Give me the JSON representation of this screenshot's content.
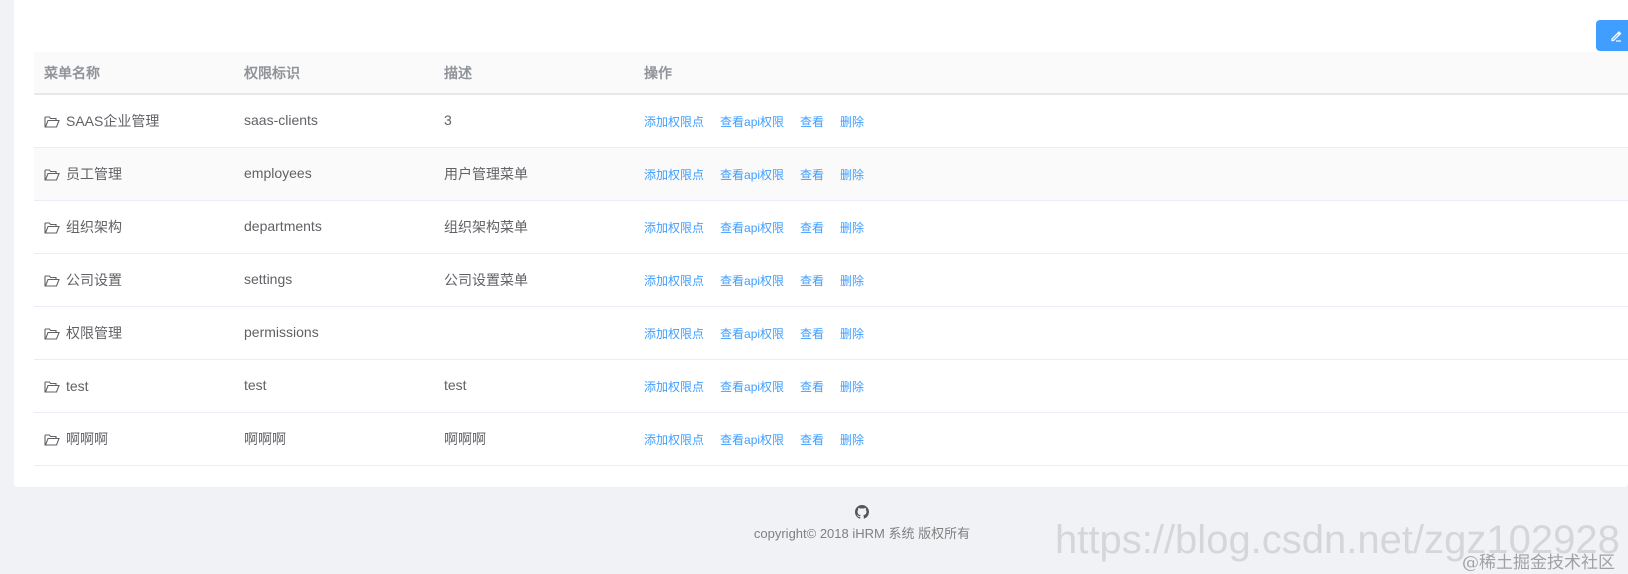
{
  "table": {
    "headers": {
      "name": "菜单名称",
      "code": "权限标识",
      "description": "描述",
      "actions": "操作"
    },
    "rows": [
      {
        "name": "SAAS企业管理",
        "code": "saas-clients",
        "description": "3"
      },
      {
        "name": "员工管理",
        "code": "employees",
        "description": "用户管理菜单"
      },
      {
        "name": "组织架构",
        "code": "departments",
        "description": "组织架构菜单"
      },
      {
        "name": "公司设置",
        "code": "settings",
        "description": "公司设置菜单"
      },
      {
        "name": "权限管理",
        "code": "permissions",
        "description": ""
      },
      {
        "name": "test",
        "code": "test",
        "description": "test"
      },
      {
        "name": "啊啊啊",
        "code": "啊啊啊",
        "description": "啊啊啊"
      }
    ],
    "actions": {
      "add_point": "添加权限点",
      "view_api": "查看api权限",
      "view": "查看",
      "delete": "删除"
    }
  },
  "icons": {
    "row_icon": "folder-open-icon",
    "edit_button_icon": "edit-icon",
    "footer_icon": "github-icon"
  },
  "footer": {
    "copyright": "copyright© 2018 iHRM 系统 版权所有"
  },
  "watermark": {
    "url": "https://blog.csdn.net/zgz102928",
    "community": "@稀土掘金技术社区"
  },
  "colors": {
    "primary": "#409eff",
    "background": "#f0f2f5"
  }
}
